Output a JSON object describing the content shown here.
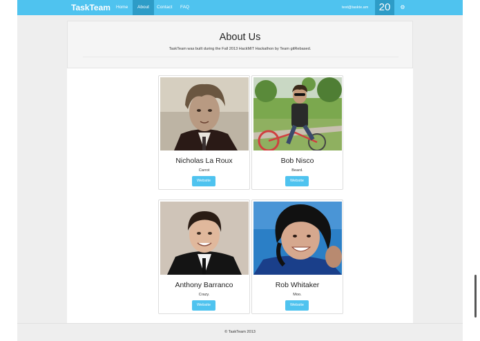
{
  "navbar": {
    "brand": "TaskTeam",
    "links": [
      {
        "label": "Home",
        "active": false
      },
      {
        "label": "About",
        "active": true
      },
      {
        "label": "Contact",
        "active": false
      },
      {
        "label": "FAQ",
        "active": false
      }
    ],
    "email": "test@taskte.am",
    "count": "20",
    "settings_icon": "gear-icon",
    "color": "#4fc3ef",
    "active_color": "#2e9cc7"
  },
  "about": {
    "title": "About Us",
    "subtitle": "TaskTeam was built during the Fall 2013 HackMIT Hackathon by Team gitRebased."
  },
  "members": [
    {
      "name": "Nicholas La Roux",
      "description": "Carrot",
      "button": "Website"
    },
    {
      "name": "Bob Nisco",
      "description": "Beard.",
      "button": "Website"
    },
    {
      "name": "Anthony Barranco",
      "description": "Crazy.",
      "button": "Website"
    },
    {
      "name": "Rob Whitaker",
      "description": "Moo.",
      "button": "Website"
    }
  ],
  "footer": {
    "text": "© TaskTeam 2013"
  }
}
